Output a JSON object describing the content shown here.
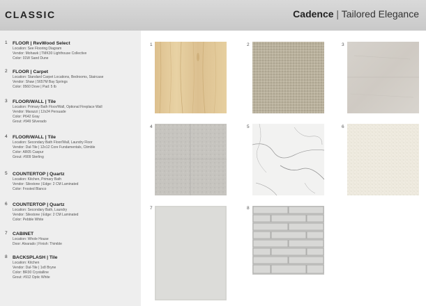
{
  "header": {
    "brand": "CLASSIC",
    "collection_name": "Cadence",
    "separator": "|",
    "collection_tagline": "Tailored Elegance"
  },
  "specs": [
    {
      "num": "1",
      "title": "FLOOR | RevWood Select",
      "lines": [
        "Location: See Flooring Diagram",
        "Vendor: Mohawk | TMK30 Lighthouse Collective",
        "Color: 01W Sand Dune"
      ]
    },
    {
      "num": "2",
      "title": "FLOOR | Carpet",
      "lines": [
        "Location: Standard Carpet Locations, Bedrooms, Staircase",
        "Vendor: Shaw | 5657M Bay Springs",
        "Color: 0560 Dove | Pad: 5 lb"
      ]
    },
    {
      "num": "3",
      "title": "FLOOR/WALL | Tile",
      "lines": [
        "Location: Primary Bath Floor/Wall, Optional Fireplace Wall",
        "Vendor: Marazzi | 12x24 Persuade",
        "Color: P642 Gray",
        "Grout: #949 Silverado"
      ]
    },
    {
      "num": "4",
      "title": "FLOOR/WALL | Tile",
      "lines": [
        "Location: Secondary Bath Floor/Wall, Laundry Floor",
        "Vendor: Dal-Tile | 12x12 Core Fundamentals, Ctimble",
        "Color: AR05 Caspur",
        "Grout: #909 Sterling"
      ]
    },
    {
      "num": "5",
      "title": "COUNTERTOP | Quartz",
      "lines": [
        "Location: Kitchen, Primary Bath",
        "Vendor: Silestone | Edge: 2 CM Laminated",
        "Color: Frosted Blanco"
      ]
    },
    {
      "num": "6",
      "title": "COUNTERTOP | Quartz",
      "lines": [
        "Location: Secondary Bath, Laundry",
        "Vendor: Silestone | Edge: 2 CM Laminated",
        "Color: Pebble White"
      ]
    },
    {
      "num": "7",
      "title": "CABINET",
      "lines": [
        "Location: Whole House",
        "Door: Alvarado | Finish: Thimble"
      ]
    },
    {
      "num": "8",
      "title": "BACKSPLASH | Tile",
      "lines": [
        "Location: Kitchen",
        "Vendor: Dal-Tile | 1x8 Bryne",
        "Color: BR30 Crystalline",
        "Grout: #912 Optic White"
      ]
    }
  ],
  "swatch_labels": [
    "1",
    "2",
    "3",
    "4",
    "5",
    "6",
    "7",
    "8"
  ]
}
